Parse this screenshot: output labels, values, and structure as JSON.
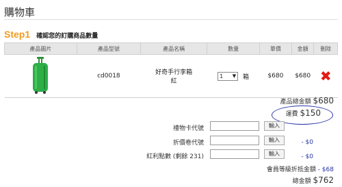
{
  "page_title": "購物車",
  "step": {
    "number": "Step1",
    "text": "確認您的訂購商品數量"
  },
  "table": {
    "headers": [
      "產品圖片",
      "產品型號",
      "產品名稱",
      "數量",
      "單價",
      "金額",
      "刪除"
    ],
    "rows": [
      {
        "image_icon": "green-luggage-image",
        "model": "cd0018",
        "name_line1": "好奇手行李箱",
        "name_line2": "紅",
        "quantity": "1",
        "quantity_unit": "箱",
        "unit_price": "$680",
        "amount": "$680",
        "delete_icon": "red-x-icon"
      }
    ]
  },
  "summary": {
    "product_total_label": "產品總金額",
    "product_total_value": "$680",
    "shipping_label": "運費",
    "shipping_value": "$150",
    "gift_card_label": "禮物卡代號",
    "discount_code_label": "折價卷代號",
    "bonus_points_label": "紅利點數 (剩餘 231)",
    "input_button_label": "輸入",
    "discount_value": "- $0",
    "bonus_value": "- $0",
    "member_discount_label": "會員等級折抵金額",
    "member_discount_value": "- $68",
    "grand_total_label": "總金額",
    "grand_total_value": "$762"
  },
  "colors": {
    "step": "#f29a1b",
    "delete": "#e21b14",
    "highlight_circle": "#2a34a8",
    "discount": "#2433a3",
    "total": "#c21b1b"
  }
}
